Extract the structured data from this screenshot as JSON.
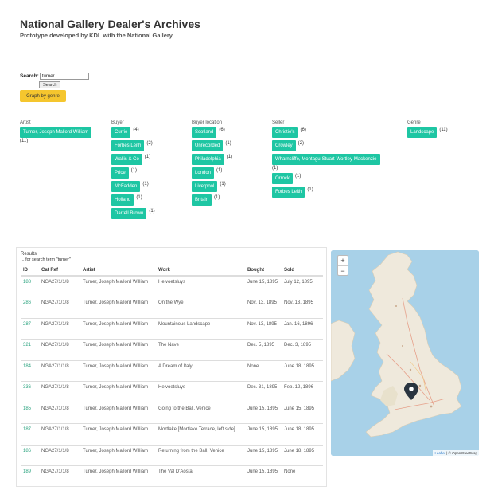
{
  "header": {
    "title": "National Gallery Dealer's Archives",
    "subtitle": "Prototype developed by KDL with the National Gallery"
  },
  "search": {
    "label": "Search:",
    "value": "turner",
    "button": "Search"
  },
  "graph_button": "Graph by genre",
  "facets": {
    "artist": {
      "heading": "Artist",
      "items": [
        {
          "label": "Turner, Joseph Mallord William",
          "count": "(11)"
        }
      ]
    },
    "buyer": {
      "heading": "Buyer",
      "items": [
        {
          "label": "Currie",
          "count": "(4)"
        },
        {
          "label": "Forbes Leith",
          "count": "(2)"
        },
        {
          "label": "Wallis & Co",
          "count": "(1)"
        },
        {
          "label": "Price",
          "count": "(1)"
        },
        {
          "label": "McFadden",
          "count": "(1)"
        },
        {
          "label": "Holland",
          "count": "(1)"
        },
        {
          "label": "Darrell Brown",
          "count": "(1)"
        }
      ]
    },
    "buyer_location": {
      "heading": "Buyer location",
      "items": [
        {
          "label": "Scotland",
          "count": "(6)"
        },
        {
          "label": "Unrecorded",
          "count": "(1)"
        },
        {
          "label": "Philadelphia",
          "count": "(1)"
        },
        {
          "label": "London",
          "count": "(1)"
        },
        {
          "label": "Liverpool",
          "count": "(1)"
        },
        {
          "label": "Britain",
          "count": "(1)"
        }
      ]
    },
    "seller": {
      "heading": "Seller",
      "items": [
        {
          "label": "Christie's",
          "count": "(6)"
        },
        {
          "label": "Crowley",
          "count": "(2)"
        },
        {
          "label": "Wharncliffe, Montagu-Stuart-Wortley-Mackenzie",
          "count": "(1)"
        },
        {
          "label": "Orrock",
          "count": "(1)"
        },
        {
          "label": "Forbes Leith",
          "count": "(1)"
        }
      ]
    },
    "genre": {
      "heading": "Genre",
      "items": [
        {
          "label": "Landscape",
          "count": "(11)"
        }
      ]
    }
  },
  "results": {
    "title": "Results",
    "subtitle": "... for search term \"turner\"",
    "columns": [
      "ID",
      "Cat Ref",
      "Artist",
      "Work",
      "Bought",
      "Sold"
    ],
    "rows": [
      {
        "id": "188",
        "ref": "NGA27/1/1/8",
        "artist": "Turner, Joseph Mallord William",
        "work": "Helvoetsluys",
        "bought": "June 15, 1895",
        "sold": "July 12, 1895"
      },
      {
        "id": "286",
        "ref": "NGA27/1/1/8",
        "artist": "Turner, Joseph Mallord William",
        "work": "On the Wye",
        "bought": "Nov. 13, 1895",
        "sold": "Nov. 13, 1895"
      },
      {
        "id": "287",
        "ref": "NGA27/1/1/8",
        "artist": "Turner, Joseph Mallord William",
        "work": "Mountainous Landscape",
        "bought": "Nov. 13, 1895",
        "sold": "Jan. 16, 1896"
      },
      {
        "id": "321",
        "ref": "NGA27/1/1/8",
        "artist": "Turner, Joseph Mallord William",
        "work": "The Nave",
        "bought": "Dec. 5, 1895",
        "sold": "Dec. 3, 1895"
      },
      {
        "id": "184",
        "ref": "NGA27/1/1/8",
        "artist": "Turner, Joseph Mallord William",
        "work": "A Dream of Italy",
        "bought": "None",
        "sold": "June 18, 1895"
      },
      {
        "id": "336",
        "ref": "NGA27/1/1/8",
        "artist": "Turner, Joseph Mallord William",
        "work": "Helvoetsluys",
        "bought": "Dec. 31, 1895",
        "sold": "Feb. 12, 1896"
      },
      {
        "id": "185",
        "ref": "NGA27/1/1/8",
        "artist": "Turner, Joseph Mallord William",
        "work": "Going to the Ball, Venice",
        "bought": "June 15, 1895",
        "sold": "June 15, 1895"
      },
      {
        "id": "187",
        "ref": "NGA27/1/1/8",
        "artist": "Turner, Joseph Mallord William",
        "work": "Mortlake [Mortlake Terrace, left side]",
        "bought": "June 15, 1895",
        "sold": "June 18, 1895"
      },
      {
        "id": "186",
        "ref": "NGA27/1/1/8",
        "artist": "Turner, Joseph Mallord William",
        "work": "Returning from the Ball, Venice",
        "bought": "June 15, 1895",
        "sold": "June 18, 1895"
      },
      {
        "id": "189",
        "ref": "NGA27/1/1/8",
        "artist": "Turner, Joseph Mallord William",
        "work": "The Val D'Aosta",
        "bought": "June 15, 1895",
        "sold": "None"
      }
    ]
  },
  "map": {
    "zoom_in": "+",
    "zoom_out": "−",
    "attribution_link": "Leaflet",
    "attribution_text": "| © OpenStreetMap",
    "land_color": "#efe9dc",
    "sea_color": "#a8d1e8",
    "marker_color": "#2a3540",
    "marker_icon": "map-pin-icon"
  },
  "colors": {
    "facet_tag": "#1ec6a3",
    "graph_button": "#f5c62e",
    "id_link": "#2ba37f"
  }
}
